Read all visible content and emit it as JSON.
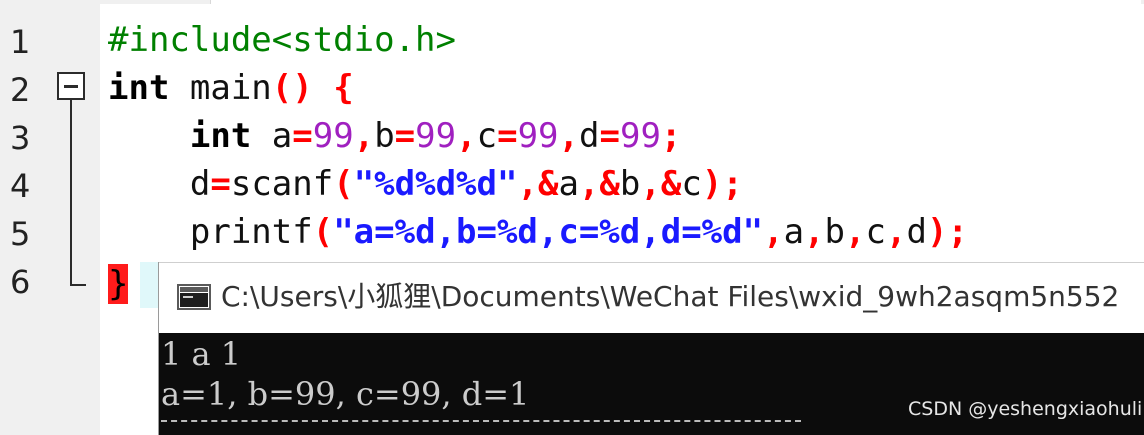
{
  "editor": {
    "line_numbers": [
      "1",
      "2",
      "3",
      "4",
      "5",
      "6"
    ],
    "lines": {
      "l1": {
        "directive": "#include<stdio.h>"
      },
      "l2": {
        "kw": "int",
        "rest": " main",
        "open": "()",
        "space": " ",
        "brace": "{"
      },
      "l3": {
        "indent": "    ",
        "kw": "int",
        "t1": " a",
        "e1": "=",
        "n1": "99",
        "c1": ",",
        "t2": "b",
        "e2": "=",
        "n2": "99",
        "c2": ",",
        "t3": "c",
        "e3": "=",
        "n3": "99",
        "c3": ",",
        "t4": "d",
        "e4": "=",
        "n4": "99",
        "semi": ";"
      },
      "l4": {
        "indent": "    ",
        "t1": "d",
        "e1": "=",
        "t2": "scanf",
        "p1": "(",
        "str": "\"%d%d%d\"",
        "c1": ",",
        "a1": "&",
        "v1": "a",
        "c2": ",",
        "a2": "&",
        "v2": "b",
        "c3": ",",
        "a3": "&",
        "v3": "c",
        "p2": ")",
        "semi": ";"
      },
      "l5": {
        "indent": "    ",
        "t1": "printf",
        "p1": "(",
        "str": "\"a=%d,b=%d,c=%d,d=%d\"",
        "c1": ",",
        "v1": "a",
        "c2": ",",
        "v2": "b",
        "c3": ",",
        "v3": "c",
        "c4": ",",
        "v4": "d",
        "p2": ")",
        "semi": ";"
      },
      "l6": {
        "brace": "}"
      }
    }
  },
  "console": {
    "title": "C:\\Users\\小狐狸\\Documents\\WeChat Files\\wxid_9wh2asqm5n552",
    "output_line1": "1 a 1",
    "output_line2": "a=1, b=99, c=99, d=1"
  },
  "watermark": "CSDN @yeshengxiaohuli",
  "colors": {
    "keyword": "#000000",
    "operator": "#ff0000",
    "number": "#a020c0",
    "string": "#1a1aff",
    "preprocessor": "#008000",
    "console_bg": "#0c0c0c",
    "gutter_bg": "#f0f0f0"
  },
  "icons": {
    "fold": "fold-collapse-icon",
    "console": "console-window-icon"
  }
}
